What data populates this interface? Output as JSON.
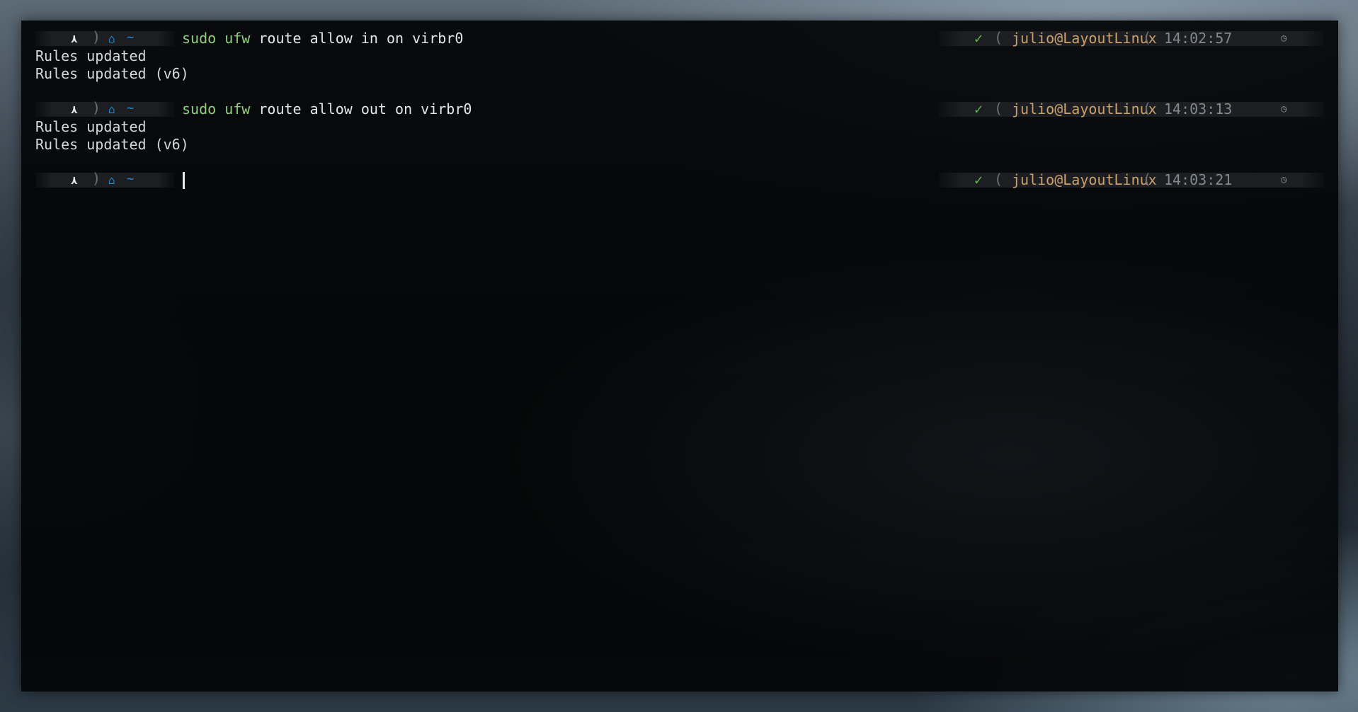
{
  "terminal": {
    "blocks": [
      {
        "prompt": {
          "os_icon": "⋏",
          "separator": ")",
          "home_icon": "⌂",
          "dir": "~",
          "cmd_word": "sudo ufw",
          "cmd_rest": " route allow in on virbr0"
        },
        "right": {
          "status": "✓",
          "separator": "(",
          "user_host": "julio@LayoutLinux",
          "time": "14:02:57",
          "clock_icon": "◷"
        },
        "output": [
          "Rules updated",
          "Rules updated (v6)"
        ]
      },
      {
        "prompt": {
          "os_icon": "⋏",
          "separator": ")",
          "home_icon": "⌂",
          "dir": "~",
          "cmd_word": "sudo ufw",
          "cmd_rest": " route allow out on virbr0"
        },
        "right": {
          "status": "✓",
          "separator": "(",
          "user_host": "julio@LayoutLinux",
          "time": "14:03:13",
          "clock_icon": "◷"
        },
        "output": [
          "Rules updated",
          "Rules updated (v6)"
        ]
      },
      {
        "prompt": {
          "os_icon": "⋏",
          "separator": ")",
          "home_icon": "⌂",
          "dir": "~",
          "cmd_word": "",
          "cmd_rest": ""
        },
        "right": {
          "status": "✓",
          "separator": "(",
          "user_host": "julio@LayoutLinux",
          "time": "14:03:21",
          "clock_icon": "◷"
        },
        "output": []
      }
    ],
    "icons": {
      "os": "arch-linux-icon",
      "home": "home-icon",
      "status": "check-icon",
      "clock": "clock-icon"
    },
    "colors": {
      "command": "#8fd07a",
      "directory": "#2a8fd0",
      "user_host": "#c9a26b",
      "time": "#7f8a8f",
      "status_ok": "#5fb84a"
    }
  }
}
